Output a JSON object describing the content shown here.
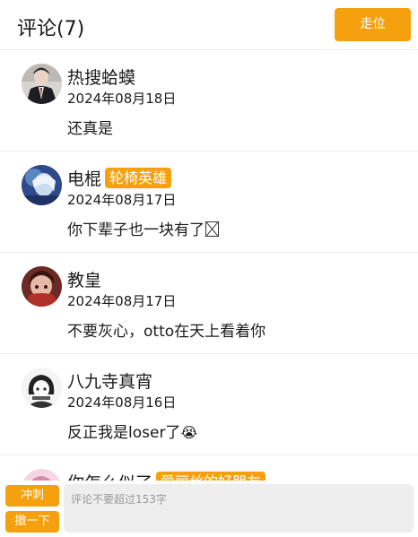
{
  "header": {
    "title": "评论(7)",
    "walk_button": "走位"
  },
  "comments": [
    {
      "username": "热搜蛤蟆",
      "badge": "",
      "date": "2024年08月18日",
      "content": "还真是",
      "avatar_icon": "man-in-suit-avatar"
    },
    {
      "username": "电棍",
      "badge": "轮椅英雄",
      "date": "2024年08月17日",
      "content": "你下辈子也一块有了",
      "avatar_icon": "blue-anime-avatar"
    },
    {
      "username": "教皇",
      "badge": "",
      "date": "2024年08月17日",
      "content": "不要灰心，otto在天上看着你",
      "avatar_icon": "red-anime-avatar"
    },
    {
      "username": "八九寺真宵",
      "badge": "",
      "date": "2024年08月16日",
      "content": "反正我是loser了",
      "avatar_icon": "monochrome-anime-avatar"
    },
    {
      "username": "你怎么似了",
      "badge": "爱丽丝的好朋友",
      "date": "",
      "content": "",
      "avatar_icon": "pink-anime-avatar"
    }
  ],
  "bottom": {
    "dash_button": "冲刺",
    "undo_button": "撤一下",
    "input_placeholder": "评论不要超过153字"
  },
  "colors": {
    "accent": "#f5a10f",
    "input_bg": "#eeeeee",
    "divider": "#ececec"
  }
}
